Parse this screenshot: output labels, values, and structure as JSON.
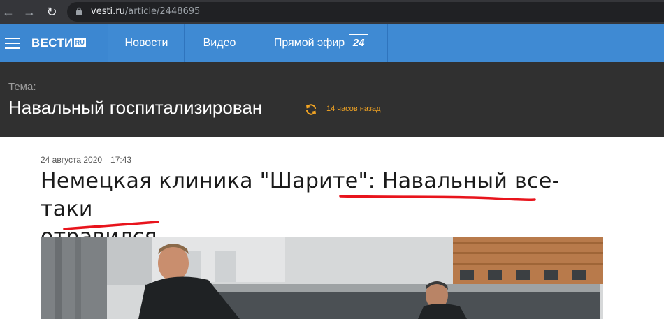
{
  "browser": {
    "url_host": "vesti.ru",
    "url_path": "/article/2448695"
  },
  "header": {
    "logo": "ВЕСТИ",
    "logo_suffix": "RU",
    "nav": [
      {
        "label": "Новости"
      },
      {
        "label": "Видео"
      },
      {
        "label": "Прямой эфир",
        "badge": "24"
      }
    ]
  },
  "topic": {
    "label": "Тема:",
    "title": "Навальный госпитализирован",
    "updated": "14 часов назад"
  },
  "article": {
    "date": "24 августа 2020",
    "time": "17:43",
    "headline_part1": "Немецкая клиника \"Шарите\": ",
    "headline_part2": "Навальный все-таки",
    "headline_part3": "отравился"
  },
  "colors": {
    "header_blue": "#3f8ad3",
    "topic_bg": "#303030",
    "accent_orange": "#f5a623",
    "annotation_red": "#e8141c"
  },
  "icons": [
    "back-arrow-icon",
    "forward-arrow-icon",
    "reload-icon",
    "lock-icon",
    "hamburger-menu-icon",
    "refresh-icon"
  ]
}
